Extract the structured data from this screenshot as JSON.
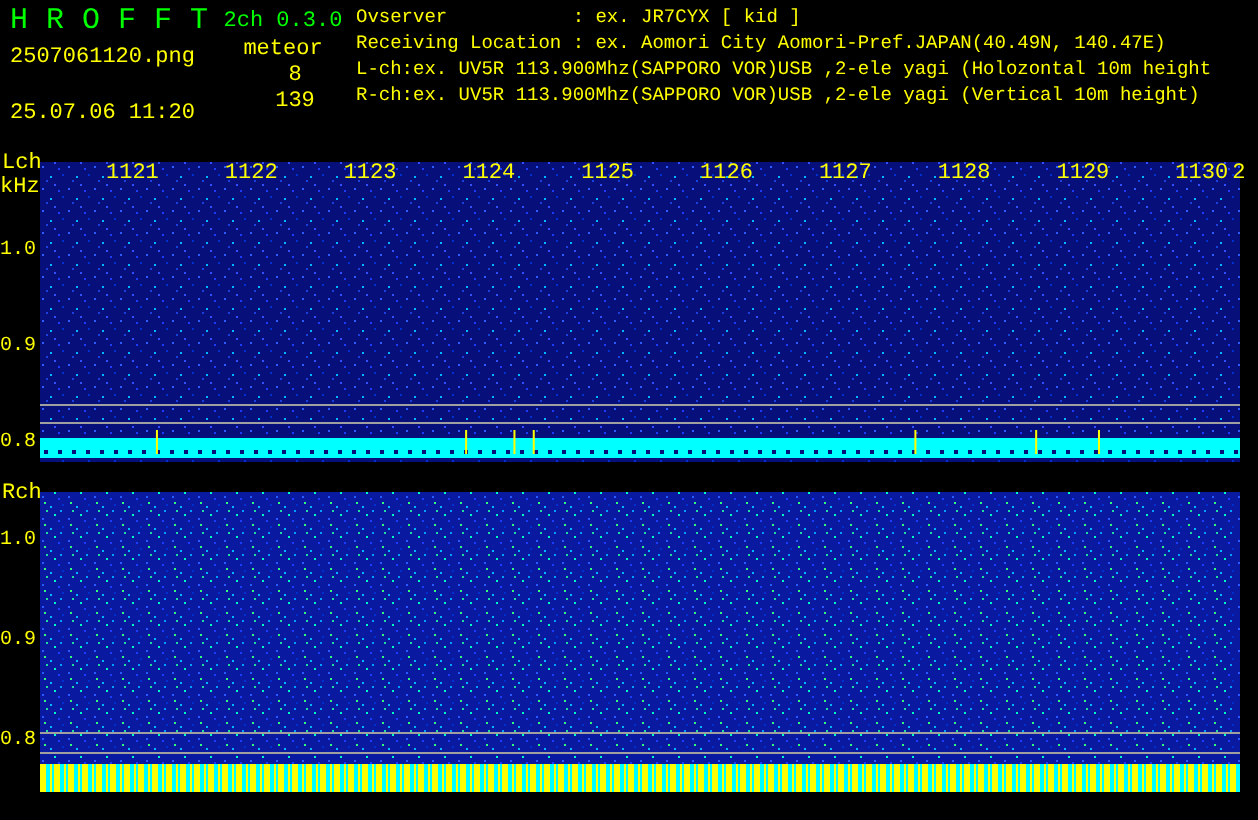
{
  "header": {
    "app_name": "HROFFT",
    "version": "2ch 0.3.0",
    "filename": "2507061120.png",
    "datetime": "25.07.06 11:20",
    "meteor_label": "meteor",
    "counts": [
      "8",
      "139"
    ],
    "info_lines": [
      "Ovserver           : ex. JR7CYX [ kid ]",
      "Receiving Location : ex. Aomori City Aomori-Pref.JAPAN(40.49N, 140.47E)",
      "L-ch:ex. UV5R 113.900Mhz(SAPPORO VOR)USB ,2-ele yagi (Holozontal 10m height",
      "R-ch:ex. UV5R 113.900Mhz(SAPPORO VOR)USB ,2-ele yagi (Vertical 10m height)"
    ]
  },
  "panels": [
    {
      "kind": "quiet",
      "label": "Lch",
      "unit": "kHz",
      "time_labels": [
        "1121",
        "1122",
        "1123",
        "1124",
        "1125",
        "1126",
        "1127",
        "1128",
        "1129",
        "1130",
        "2"
      ],
      "y_labels": [
        "1.0",
        "0.9",
        "0.8"
      ]
    },
    {
      "kind": "busy",
      "label": "Rch",
      "y_labels": [
        "1.0",
        "0.9",
        "0.8"
      ]
    }
  ]
}
